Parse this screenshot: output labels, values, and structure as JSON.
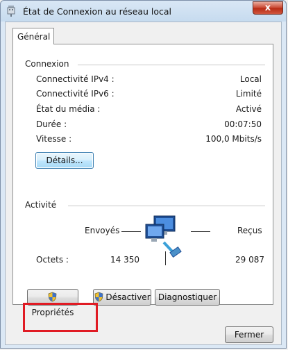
{
  "window": {
    "title": "État de Connexion au réseau local",
    "close_symbol": "x",
    "icon": "network-adapter-icon"
  },
  "tabs": [
    {
      "label": "Général",
      "selected": true
    }
  ],
  "connexion": {
    "heading": "Connexion",
    "rows": [
      {
        "label": "Connectivité IPv4 :",
        "value": "Local"
      },
      {
        "label": "Connectivité IPv6 :",
        "value": "Limité"
      },
      {
        "label": "État du média :",
        "value": "Activé"
      },
      {
        "label": "Durée :",
        "value": "00:07:50"
      },
      {
        "label": "Vitesse :",
        "value": "100,0 Mbits/s"
      }
    ],
    "details_button": "Détails..."
  },
  "activite": {
    "heading": "Activité",
    "sent_label": "Envoyés",
    "received_label": "Reçus",
    "bytes_label": "Octets :",
    "bytes_sent": "14 350",
    "bytes_received": "29 087",
    "icon": "network-computers-icon"
  },
  "buttons": {
    "properties": "Propriétés",
    "disable": "Désactiver",
    "diagnose": "Diagnostiquer",
    "close": "Fermer"
  },
  "colors": {
    "highlight": "#e01b24",
    "title_bar": "#c6dbef",
    "close_button": "#c8452f"
  }
}
